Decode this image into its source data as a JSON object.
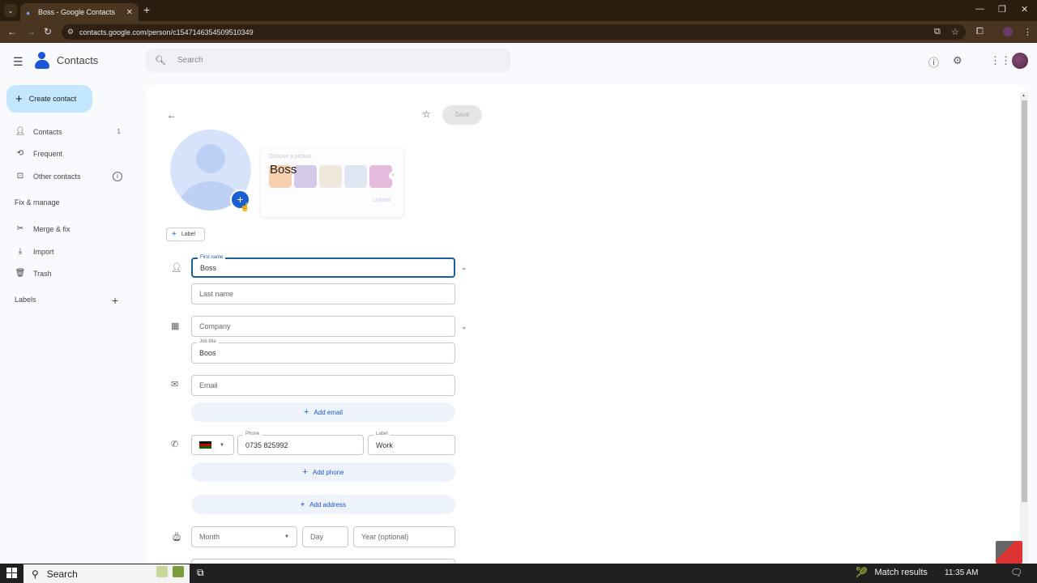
{
  "browser": {
    "tab_title": "Boss - Google Contacts",
    "url": "contacts.google.com/person/c1547146354509510349",
    "new_tab_icon": "plus-icon",
    "window_controls": [
      "minimize-icon",
      "restore-icon",
      "close-icon"
    ]
  },
  "header": {
    "brand": "Contacts",
    "search_placeholder": "Search",
    "icons": [
      "help-icon",
      "settings-icon",
      "apps-icon",
      "avatar"
    ]
  },
  "sidebar": {
    "create_label": "Create contact",
    "items": [
      {
        "label": "Contacts",
        "count": "1",
        "icon": "person-icon"
      },
      {
        "label": "Frequent",
        "icon": "history-icon"
      },
      {
        "label": "Other contacts",
        "icon": "inbox-icon"
      }
    ],
    "fix_header": "Fix & manage",
    "fix_items": [
      {
        "label": "Merge & fix",
        "icon": "tools-icon"
      },
      {
        "label": "Import",
        "icon": "download-icon"
      },
      {
        "label": "Trash",
        "icon": "trash-icon"
      }
    ],
    "labels_header": "Labels"
  },
  "editor": {
    "save_label": "Save",
    "picker": {
      "title": "Choose a picture",
      "name_overlay": "Boss",
      "upload_label": "Upload",
      "thumb_colors": [
        "#f3b47a",
        "#b8a6d9",
        "#e6dcc7",
        "#c9d7ea",
        "#d48fc4"
      ]
    },
    "label_button": "Label",
    "fields": {
      "first_name": {
        "label": "First name",
        "value": "Boss"
      },
      "last_name": {
        "placeholder": "Last name"
      },
      "company": {
        "placeholder": "Company"
      },
      "job_title": {
        "label": "Job title",
        "value": "Boos"
      },
      "email": {
        "placeholder": "Email"
      },
      "phone": {
        "label": "Phone",
        "value": "0735 825992",
        "country": "Kenya"
      },
      "phone_label": {
        "label": "Label",
        "value": "Work"
      },
      "month": {
        "placeholder": "Month"
      },
      "day": {
        "placeholder": "Day"
      },
      "year": {
        "placeholder": "Year (optional)"
      }
    },
    "add_email": "Add email",
    "add_phone": "Add phone",
    "add_address": "Add address"
  },
  "taskbar": {
    "search_label": "Search",
    "widget": "Match results",
    "time": "11:35 AM"
  }
}
